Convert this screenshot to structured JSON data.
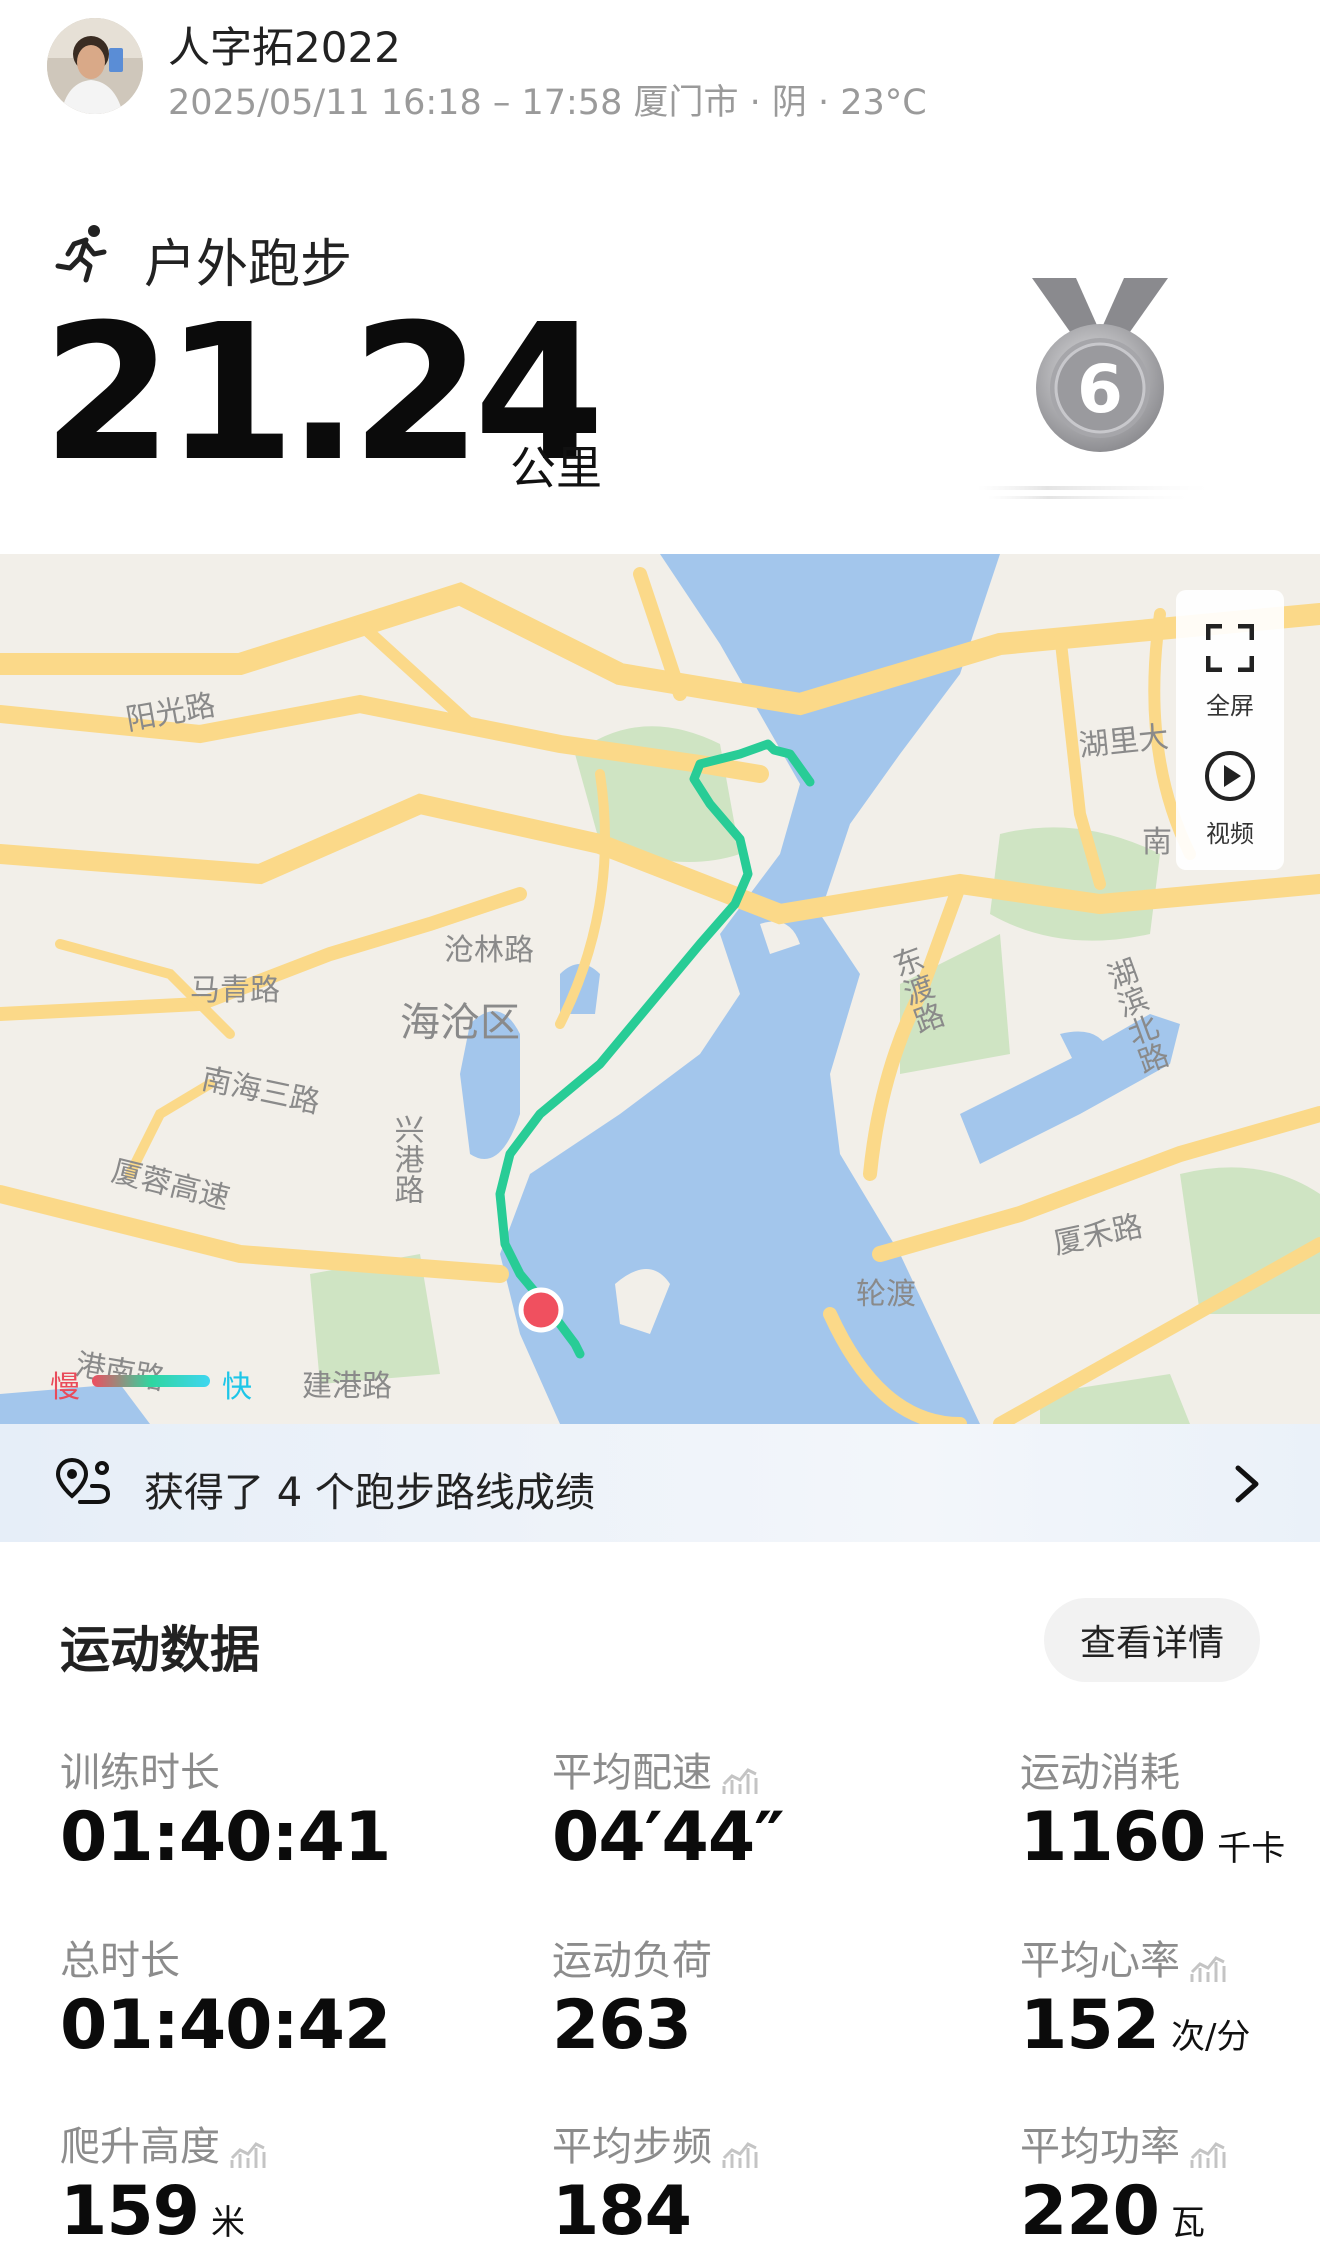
{
  "header": {
    "user_name": "人字拓2022",
    "meta": "2025/05/11 16:18 – 17:58 厦门市 · 阴 · 23°C",
    "avatar_icon": "user-avatar"
  },
  "activity": {
    "type": "户外跑步",
    "distance": "21.24",
    "unit": "公里",
    "medal_number": "6",
    "type_icon": "runner-icon"
  },
  "map": {
    "labels": {
      "yangguang": "阳光路",
      "huli": "湖里大",
      "nan": "南",
      "canglin": "沧林路",
      "maqing": "马青路",
      "haicang": "海沧区",
      "nanhai": "南海三路",
      "xinggang": "兴港路",
      "dongdu": "东渡路",
      "hubin": "湖滨北路",
      "xiarong": "厦蓉高速",
      "xiahe": "厦禾路",
      "lundu": "轮渡",
      "gangnan": "港南路",
      "jiangang": "建港路"
    },
    "controls": {
      "fullscreen": "全屏",
      "video": "视频"
    },
    "legend": {
      "slow": "慢",
      "fast": "快"
    }
  },
  "route_banner": {
    "text": "获得了 4 个跑步路线成绩"
  },
  "stats": {
    "title": "运动数据",
    "detail_button": "查看详情",
    "items": [
      {
        "label": "训练时长",
        "value": "01:40:41",
        "unit": ""
      },
      {
        "label": "平均配速",
        "value": "04′44″",
        "unit": ""
      },
      {
        "label": "运动消耗",
        "value": "1160",
        "unit": "千卡"
      },
      {
        "label": "总时长",
        "value": "01:40:42",
        "unit": ""
      },
      {
        "label": "运动负荷",
        "value": "263",
        "unit": ""
      },
      {
        "label": "平均心率",
        "value": "152",
        "unit": "次/分"
      },
      {
        "label": "爬升高度",
        "value": "159",
        "unit": "米"
      },
      {
        "label": "平均步频",
        "value": "184",
        "unit": ""
      },
      {
        "label": "平均功率",
        "value": "220",
        "unit": "瓦"
      }
    ]
  }
}
